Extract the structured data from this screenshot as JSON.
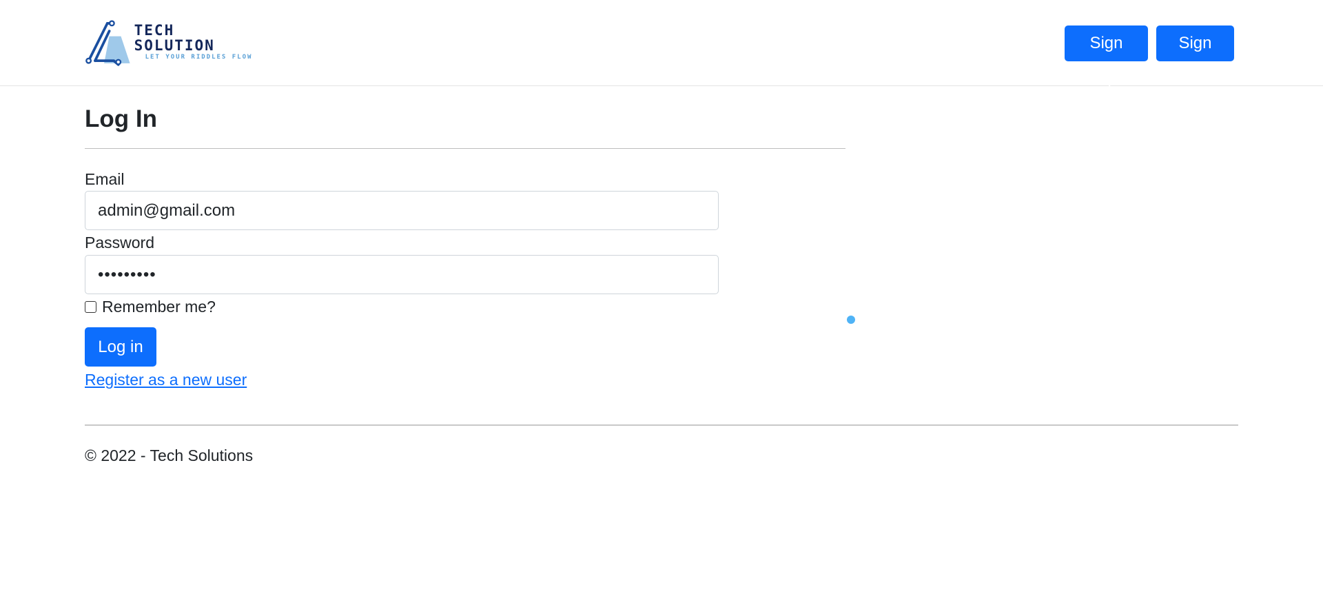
{
  "header": {
    "logo": {
      "title": "TECH SOLUTION",
      "tagline": "LET YOUR RIDDLES FLOW",
      "icon": "triangle-circuit-logo-icon"
    },
    "nav": {
      "signup_label": "Sign Up",
      "signin_label": "Sign In"
    }
  },
  "main": {
    "title": "Log In",
    "form": {
      "email_label": "Email",
      "email_value": "admin@gmail.com",
      "password_label": "Password",
      "password_value": "•••••••••",
      "remember_label": "Remember me?",
      "remember_checked": false,
      "submit_label": "Log in",
      "register_link": "Register as a new user"
    }
  },
  "footer": {
    "text": "© 2022 - Tech Solutions"
  },
  "colors": {
    "primary": "#0d6efd",
    "logo_dark": "#14275a",
    "logo_light": "#5aa0d6",
    "cursor": "#4fb3f6"
  }
}
